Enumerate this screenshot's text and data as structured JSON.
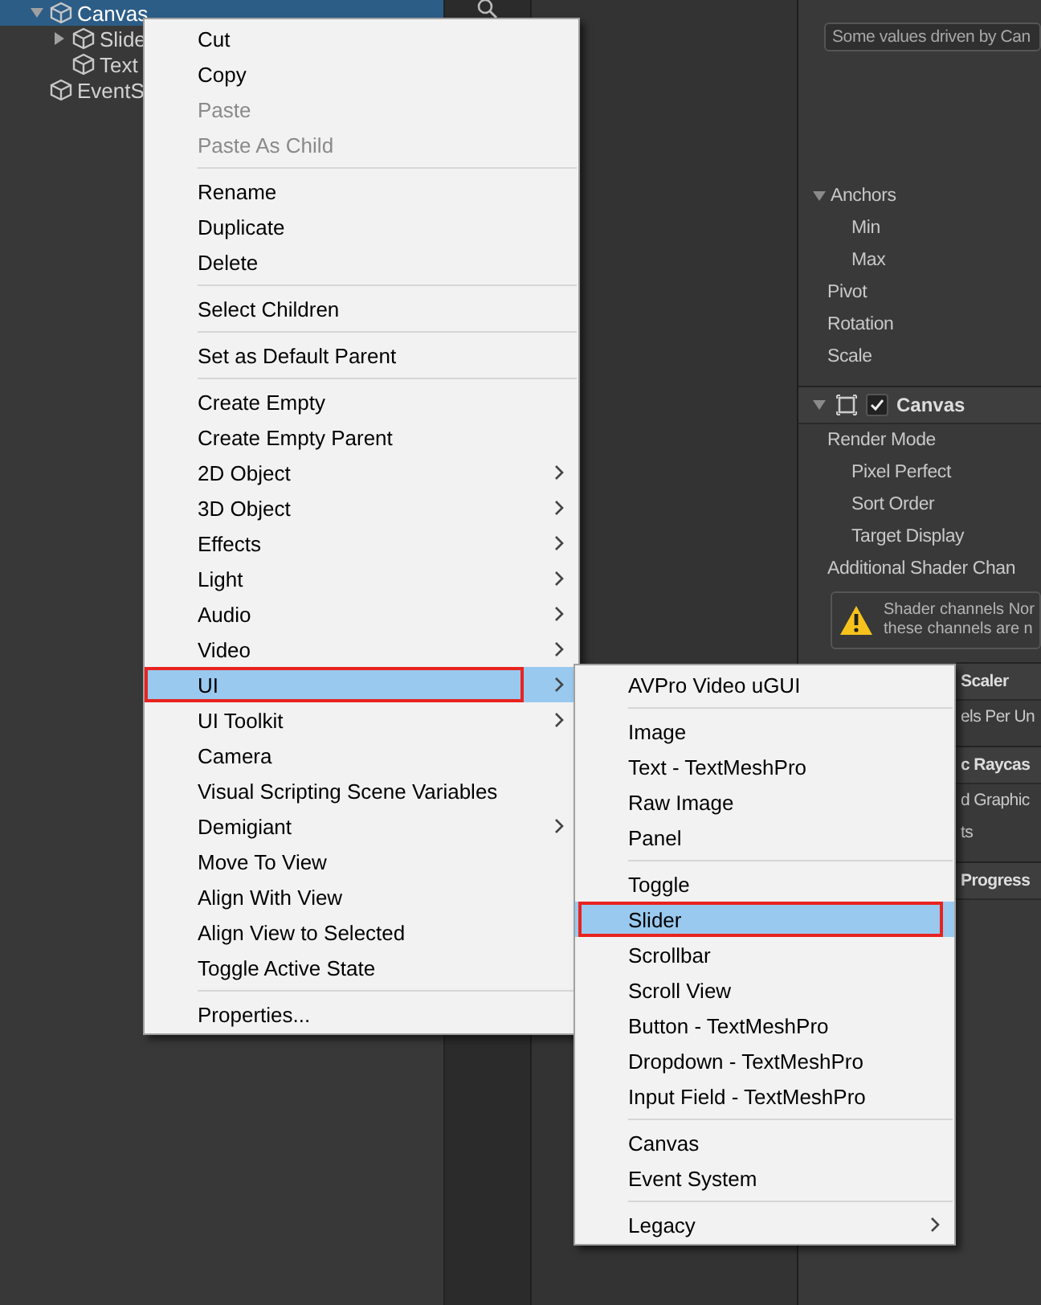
{
  "hierarchy": {
    "items": [
      {
        "label": "Canvas",
        "selected": true,
        "expanded": true,
        "children": [
          {
            "label": "Slide",
            "selected": false,
            "expanded": false
          },
          {
            "label": "Text",
            "selected": false
          }
        ]
      },
      {
        "label": "EventS",
        "selected": false
      }
    ]
  },
  "inspector": {
    "rows": [
      {
        "kind": "field",
        "label": "Some values driven by Can"
      },
      {
        "kind": "foldout",
        "label": "Anchors",
        "expanded": true
      },
      {
        "kind": "subrow",
        "label": "Min"
      },
      {
        "kind": "subrow",
        "label": "Max"
      },
      {
        "kind": "row",
        "label": "Pivot"
      },
      {
        "kind": "row",
        "label": "Rotation"
      },
      {
        "kind": "row",
        "label": "Scale"
      },
      {
        "kind": "header",
        "label": "Canvas",
        "checked": true
      },
      {
        "kind": "row",
        "label": "Render Mode"
      },
      {
        "kind": "subrow",
        "label": "Pixel Perfect"
      },
      {
        "kind": "subrow",
        "label": "Sort Order"
      },
      {
        "kind": "subrow",
        "label": "Target Display"
      },
      {
        "kind": "row",
        "label": "Additional Shader Chan"
      },
      {
        "kind": "warning",
        "lines": [
          "Shader channels Nor",
          "these channels are n"
        ]
      },
      {
        "kind": "covered_header",
        "label": "Scaler"
      },
      {
        "kind": "covered_row",
        "label": "els Per Un"
      },
      {
        "kind": "covered_header",
        "label": "c Raycas"
      },
      {
        "kind": "covered_row",
        "label": "d Graphic"
      },
      {
        "kind": "covered_row",
        "label": "ts"
      },
      {
        "kind": "covered_header",
        "label": "Progress"
      }
    ]
  },
  "context_menu": {
    "sections": [
      {
        "items": [
          {
            "label": "Cut",
            "disabled": false,
            "submenu": false,
            "selected": false
          },
          {
            "label": "Copy",
            "disabled": false,
            "submenu": false,
            "selected": false
          },
          {
            "label": "Paste",
            "disabled": true,
            "submenu": false,
            "selected": false
          },
          {
            "label": "Paste As Child",
            "disabled": true,
            "submenu": false,
            "selected": false
          }
        ]
      },
      {
        "items": [
          {
            "label": "Rename",
            "disabled": false,
            "submenu": false,
            "selected": false
          },
          {
            "label": "Duplicate",
            "disabled": false,
            "submenu": false,
            "selected": false
          },
          {
            "label": "Delete",
            "disabled": false,
            "submenu": false,
            "selected": false
          }
        ]
      },
      {
        "items": [
          {
            "label": "Select Children",
            "disabled": false,
            "submenu": false,
            "selected": false
          }
        ]
      },
      {
        "items": [
          {
            "label": "Set as Default Parent",
            "disabled": false,
            "submenu": false,
            "selected": false
          }
        ]
      },
      {
        "items": [
          {
            "label": "Create Empty",
            "disabled": false,
            "submenu": false,
            "selected": false
          },
          {
            "label": "Create Empty Parent",
            "disabled": false,
            "submenu": false,
            "selected": false
          },
          {
            "label": "2D Object",
            "disabled": false,
            "submenu": true,
            "selected": false
          },
          {
            "label": "3D Object",
            "disabled": false,
            "submenu": true,
            "selected": false
          },
          {
            "label": "Effects",
            "disabled": false,
            "submenu": true,
            "selected": false
          },
          {
            "label": "Light",
            "disabled": false,
            "submenu": true,
            "selected": false
          },
          {
            "label": "Audio",
            "disabled": false,
            "submenu": true,
            "selected": false
          },
          {
            "label": "Video",
            "disabled": false,
            "submenu": true,
            "selected": false
          },
          {
            "label": "UI",
            "disabled": false,
            "submenu": true,
            "selected": true
          },
          {
            "label": "UI Toolkit",
            "disabled": false,
            "submenu": true,
            "selected": false
          },
          {
            "label": "Camera",
            "disabled": false,
            "submenu": false,
            "selected": false
          },
          {
            "label": "Visual Scripting Scene Variables",
            "disabled": false,
            "submenu": false,
            "selected": false
          },
          {
            "label": "Demigiant",
            "disabled": false,
            "submenu": true,
            "selected": false
          },
          {
            "label": "Move To View",
            "disabled": false,
            "submenu": false,
            "selected": false
          },
          {
            "label": "Align With View",
            "disabled": false,
            "submenu": false,
            "selected": false
          },
          {
            "label": "Align View to Selected",
            "disabled": false,
            "submenu": false,
            "selected": false
          },
          {
            "label": "Toggle Active State",
            "disabled": false,
            "submenu": false,
            "selected": false
          }
        ]
      },
      {
        "items": [
          {
            "label": "Properties...",
            "disabled": false,
            "submenu": false,
            "selected": false
          }
        ]
      }
    ]
  },
  "submenu": {
    "sections": [
      {
        "items": [
          {
            "label": "AVPro Video uGUI",
            "disabled": false,
            "submenu": false,
            "selected": false
          }
        ]
      },
      {
        "items": [
          {
            "label": "Image",
            "disabled": false,
            "submenu": false,
            "selected": false
          },
          {
            "label": "Text - TextMeshPro",
            "disabled": false,
            "submenu": false,
            "selected": false
          },
          {
            "label": "Raw Image",
            "disabled": false,
            "submenu": false,
            "selected": false
          },
          {
            "label": "Panel",
            "disabled": false,
            "submenu": false,
            "selected": false
          }
        ]
      },
      {
        "items": [
          {
            "label": "Toggle",
            "disabled": false,
            "submenu": false,
            "selected": false
          },
          {
            "label": "Slider",
            "disabled": false,
            "submenu": false,
            "selected": true
          },
          {
            "label": "Scrollbar",
            "disabled": false,
            "submenu": false,
            "selected": false
          },
          {
            "label": "Scroll View",
            "disabled": false,
            "submenu": false,
            "selected": false
          },
          {
            "label": "Button - TextMeshPro",
            "disabled": false,
            "submenu": false,
            "selected": false
          },
          {
            "label": "Dropdown - TextMeshPro",
            "disabled": false,
            "submenu": false,
            "selected": false
          },
          {
            "label": "Input Field - TextMeshPro",
            "disabled": false,
            "submenu": false,
            "selected": false
          }
        ]
      },
      {
        "items": [
          {
            "label": "Canvas",
            "disabled": false,
            "submenu": false,
            "selected": false
          },
          {
            "label": "Event System",
            "disabled": false,
            "submenu": false,
            "selected": false
          }
        ]
      },
      {
        "items": [
          {
            "label": "Legacy",
            "disabled": false,
            "submenu": true,
            "selected": false
          }
        ]
      }
    ]
  }
}
